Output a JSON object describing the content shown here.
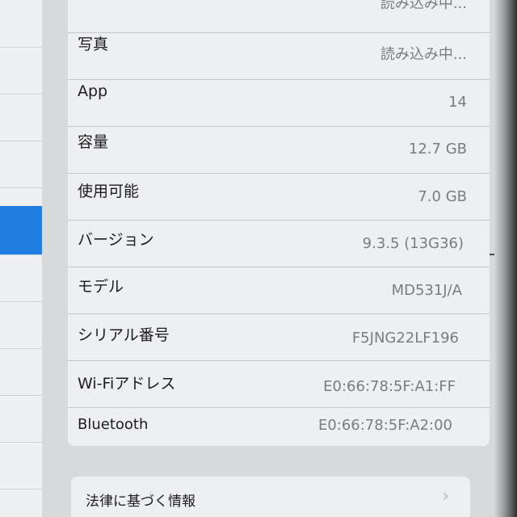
{
  "about_rows": [
    {
      "label": "",
      "value": "読み込み中..."
    },
    {
      "label": "写真",
      "value": "読み込み中..."
    },
    {
      "label": "App",
      "value": "14"
    },
    {
      "label": "容量",
      "value": "12.7 GB"
    },
    {
      "label": "使用可能",
      "value": "7.0 GB"
    },
    {
      "label": "バージョン",
      "value": "9.3.5 (13G36)"
    },
    {
      "label": "モデル",
      "value": "MD531J/A"
    },
    {
      "label": "シリアル番号",
      "value": "F5JNG22LF196"
    },
    {
      "label": "Wi-Fiアドレス",
      "value": "E0:66:78:5F:A1:FF"
    },
    {
      "label": "Bluetooth",
      "value": "E0:66:78:5F:A2:00"
    }
  ],
  "legal": {
    "label": "法律に基づく情報",
    "chevron": "›"
  },
  "icons": {
    "chevron": "chevron-right-icon"
  },
  "colors": {
    "selection": "#1f7fe0",
    "card_background": "#eeeff0",
    "value_text": "#7a7c80",
    "label_text": "#1c1c1e"
  }
}
